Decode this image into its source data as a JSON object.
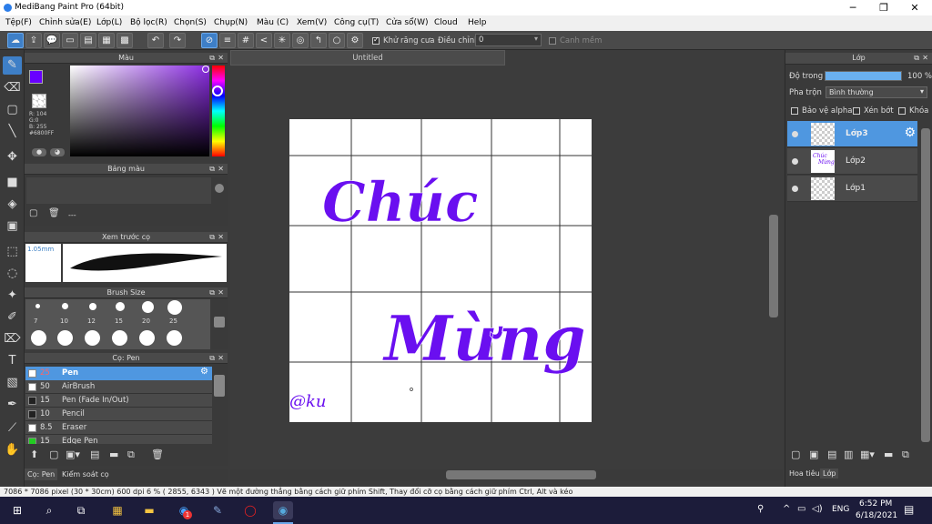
{
  "window": {
    "title": "MediBang Paint Pro (64bit)",
    "minimize": "─",
    "maximize": "❐",
    "close": "✕"
  },
  "menu": [
    "Tệp(F)",
    "Chỉnh sửa(E)",
    "Lớp(L)",
    "Bộ lọc(R)",
    "Chọn(S)",
    "Chụp(N)",
    "Màu (C)",
    "Xem(V)",
    "Công cụ(T)",
    "Cửa sổ(W)",
    "Cloud",
    "Help"
  ],
  "options": {
    "antialias": "Khử răng cưa",
    "adjust": "Điều chỉnh",
    "adjust_value": "0",
    "snap": "Canh mềm"
  },
  "color_panel": {
    "title": "Màu",
    "r": "R: 104",
    "g": "G:0",
    "b": "B: 255",
    "hex": "#6800FF",
    "main_color": "#6800ff"
  },
  "palette_panel": {
    "title": "Bảng màu",
    "value": "---"
  },
  "brush_preview": {
    "title": "Xem trước cọ",
    "size": "1.05mm"
  },
  "brush_size": {
    "title": "Brush Size",
    "sizes": [
      "7",
      "10",
      "12",
      "15",
      "20",
      "25"
    ]
  },
  "brush_list": {
    "title": "Cọ: Pen",
    "items": [
      {
        "size": "25",
        "name": "Pen",
        "color": "#ffffff"
      },
      {
        "size": "50",
        "name": "AirBrush",
        "color": "#ffffff"
      },
      {
        "size": "15",
        "name": "Pen (Fade In/Out)",
        "color": "#222222"
      },
      {
        "size": "10",
        "name": "Pencil",
        "color": "#222222"
      },
      {
        "size": "8.5",
        "name": "Eraser",
        "color": "#ffffff"
      },
      {
        "size": "15",
        "name": "Edge Pen",
        "color": "#22cc22"
      }
    ]
  },
  "left_tabs": [
    "Cọ: Pen",
    "Kiểm soát cọ"
  ],
  "document": {
    "tab": "Untitled",
    "text_top": "Chúc",
    "text_bottom": "Mừng",
    "text_small": "@ku",
    "ink_color": "#6a0ff0"
  },
  "layer_panel": {
    "title": "Lớp",
    "opacity_label": "Độ trong",
    "opacity_value": "100 %",
    "opacity": 1.0,
    "blend_label": "Pha trộn",
    "blend_value": "Bình thường",
    "protect_alpha": "Bảo vệ alpha",
    "clipping": "Xén bớt",
    "lock": "Khóa",
    "layers": [
      "Lớp3",
      "Lớp2",
      "Lớp1"
    ],
    "thumb_top": "Chúc",
    "thumb_bottom": "Mừng",
    "tabs": [
      "Hoa tiêu",
      "Lớp"
    ]
  },
  "status": "7086 * 7086 pixel  (30 * 30cm)  600 dpi  6 %  ( 2855, 6343 )  Vẽ một đường thẳng bằng cách giữ phím Shift, Thay đổi cỡ cọ bằng cách giữ phím Ctrl, Alt và kéo",
  "taskbar": {
    "lang": "ENG",
    "time": "6:52 PM",
    "date": "6/18/2021",
    "badge": "1"
  }
}
